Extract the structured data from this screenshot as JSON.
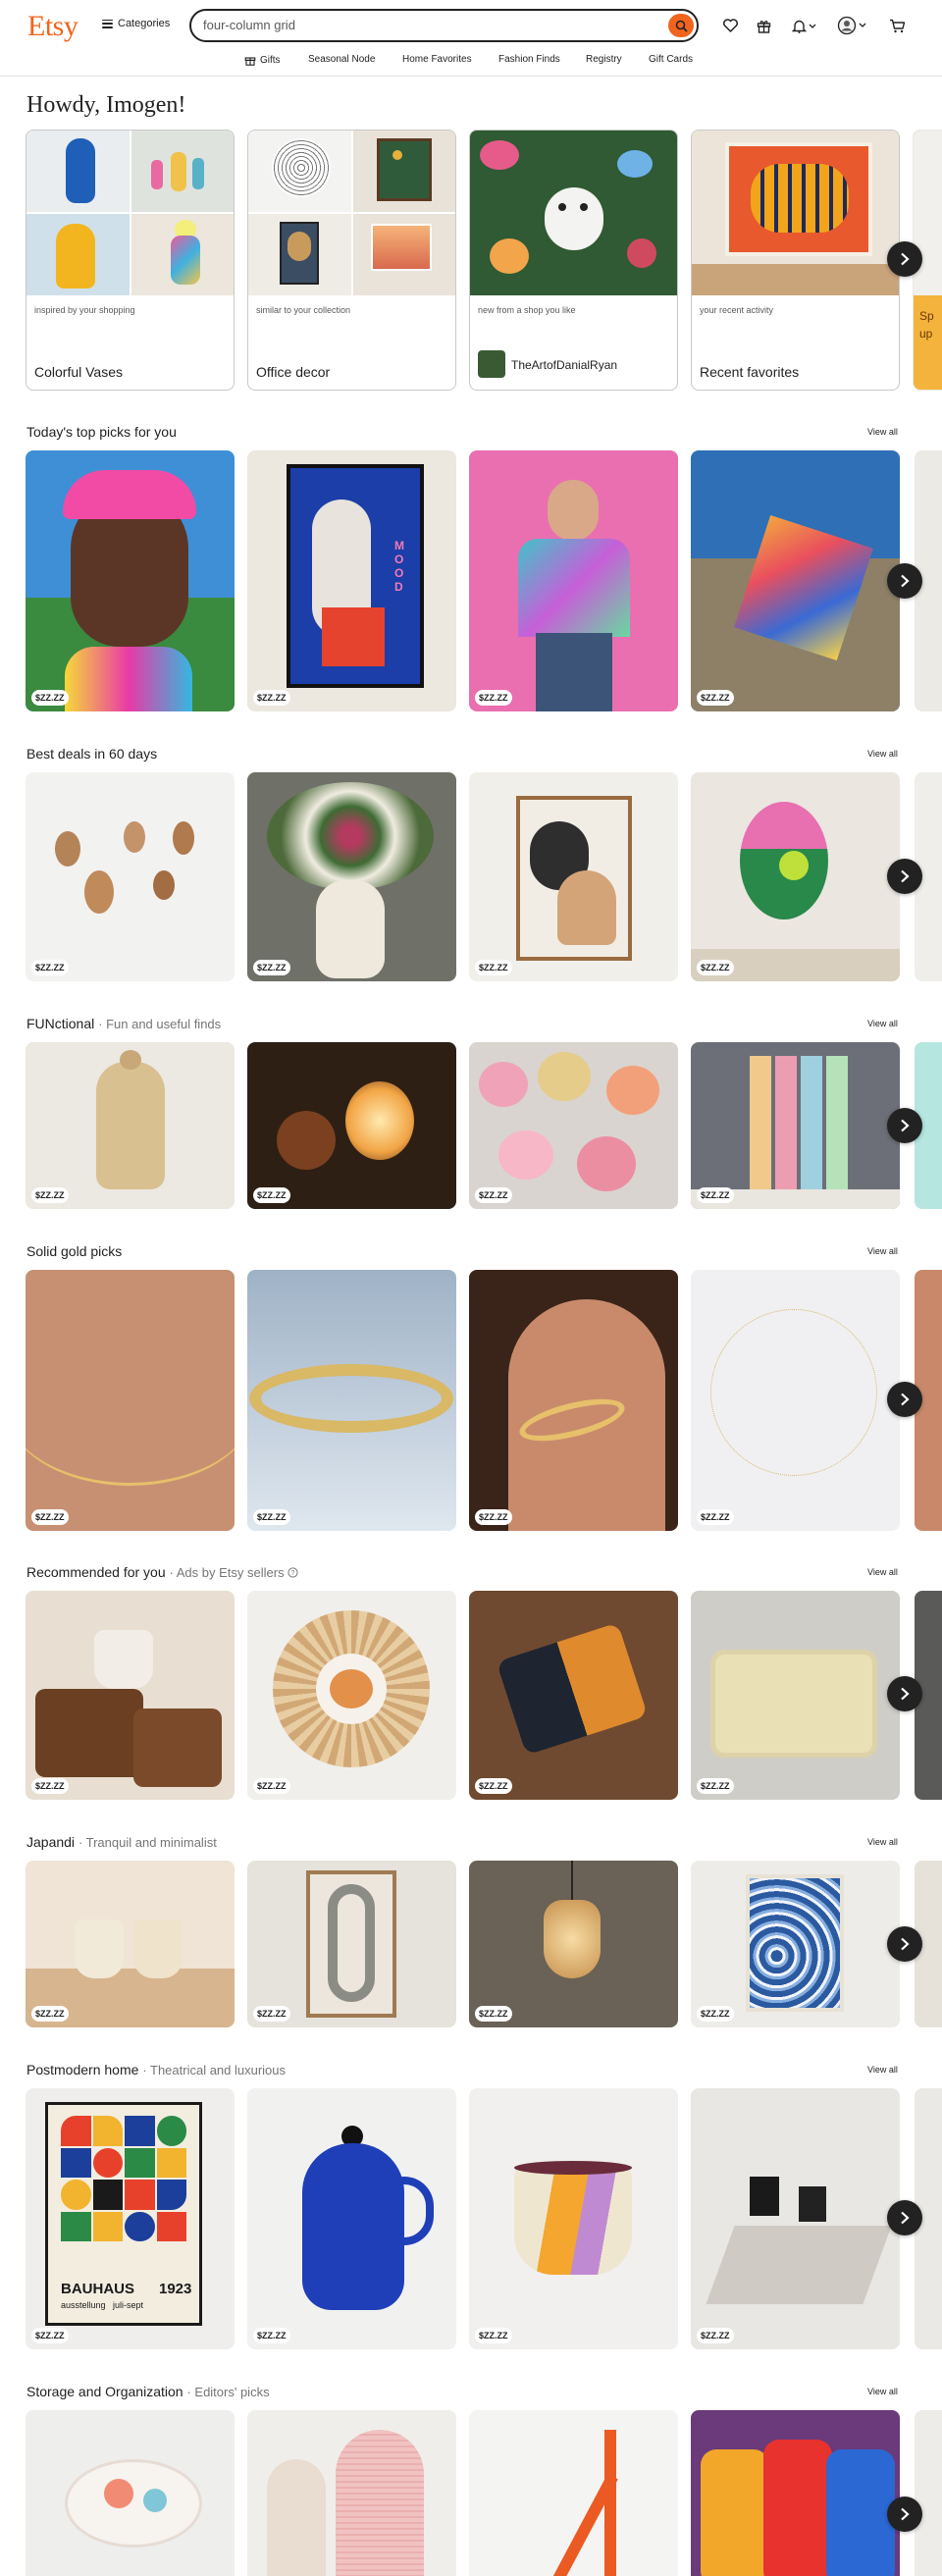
{
  "header": {
    "logo": "Etsy",
    "categories_label": "Categories",
    "search_value": "four-column grid",
    "icons": [
      "favorites-icon",
      "gift-icon",
      "notifications-icon",
      "account-icon",
      "cart-icon"
    ]
  },
  "subnav": [
    "Gifts",
    "Seasonal Node",
    "Home Favorites",
    "Fashion Finds",
    "Registry",
    "Gift Cards"
  ],
  "greeting": "Howdy, Imogen!",
  "top_cards": [
    {
      "caption": "inspired by your shopping",
      "title": "Colorful Vases"
    },
    {
      "caption": "similar to your collection",
      "title": "Office decor"
    },
    {
      "caption": "new from a shop you like",
      "title": "TheArtofDanialRyan"
    },
    {
      "caption": "your recent activity",
      "title": "Recent favorites"
    },
    {
      "caption": "",
      "title": "Sp up"
    }
  ],
  "price_placeholder": "$ZZ.ZZ",
  "view_all_label": "View all",
  "sections": [
    {
      "title": "Today's top picks for you",
      "subtitle": ""
    },
    {
      "title": "Best deals in 60 days",
      "subtitle": ""
    },
    {
      "title": "FUNctional",
      "subtitle": "· Fun and useful finds"
    },
    {
      "title": "Solid gold picks",
      "subtitle": ""
    },
    {
      "title": "Recommended for you",
      "subtitle": "· Ads by Etsy sellers"
    },
    {
      "title": "Japandi",
      "subtitle": "· Tranquil and minimalist"
    },
    {
      "title": "Postmodern home",
      "subtitle": "· Theatrical and luxurious"
    },
    {
      "title": "Storage and Organization",
      "subtitle": "· Editors' picks"
    }
  ],
  "poster_text": {
    "mood": "MOOD",
    "bauhaus": "BAUHAUS",
    "year": "1923",
    "sub": "ausstellung   juli-sept"
  },
  "colors": {
    "brand": "#F1641E",
    "text": "#222222",
    "muted": "#595959",
    "border": "#c9c9c9"
  }
}
